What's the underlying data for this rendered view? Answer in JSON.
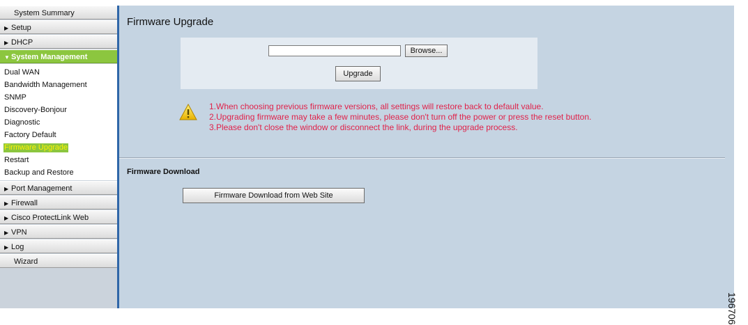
{
  "sidebar": {
    "top_items": [
      {
        "label": "System Summary",
        "arrow": ""
      },
      {
        "label": "Setup",
        "arrow": "▶"
      },
      {
        "label": "DHCP",
        "arrow": "▶"
      }
    ],
    "active_section": {
      "label": "System Management",
      "arrow": "▼"
    },
    "sub_items": [
      {
        "label": "Dual WAN"
      },
      {
        "label": "Bandwidth Management"
      },
      {
        "label": "SNMP"
      },
      {
        "label": "Discovery-Bonjour"
      },
      {
        "label": "Diagnostic"
      },
      {
        "label": "Factory Default"
      },
      {
        "label": "Firmware Upgrade"
      },
      {
        "label": "Restart"
      },
      {
        "label": "Backup and Restore"
      }
    ],
    "bottom_items": [
      {
        "label": "Port Management",
        "arrow": "▶"
      },
      {
        "label": "Firewall",
        "arrow": "▶"
      },
      {
        "label": "Cisco ProtectLink Web",
        "arrow": "▶"
      },
      {
        "label": "VPN",
        "arrow": "▶"
      },
      {
        "label": "Log",
        "arrow": "▶"
      },
      {
        "label": "Wizard",
        "arrow": ""
      }
    ]
  },
  "main": {
    "title": "Firmware Upgrade",
    "file_input_value": "",
    "browse_label": "Browse...",
    "upgrade_label": "Upgrade",
    "warning_icon": "warning-triangle-icon",
    "warnings": [
      "1.When choosing previous firmware versions, all settings will restore back to default value.",
      "2.Upgrading firmware may take a few minutes, please don't turn off the power or press the reset button.",
      "3.Please don't close the window or disconnect the link, during the upgrade process."
    ],
    "download_section_label": "Firmware Download",
    "download_button_label": "Firmware Download from Web Site"
  },
  "figure_number": "196706",
  "colors": {
    "sidebar_bg": "#cbd3dc",
    "active_green": "#8cc63f",
    "main_bg": "#c5d4e2",
    "panel_bg": "#e4ebf2",
    "warning_text": "#e0224a",
    "border_blue": "#2f66a8"
  }
}
